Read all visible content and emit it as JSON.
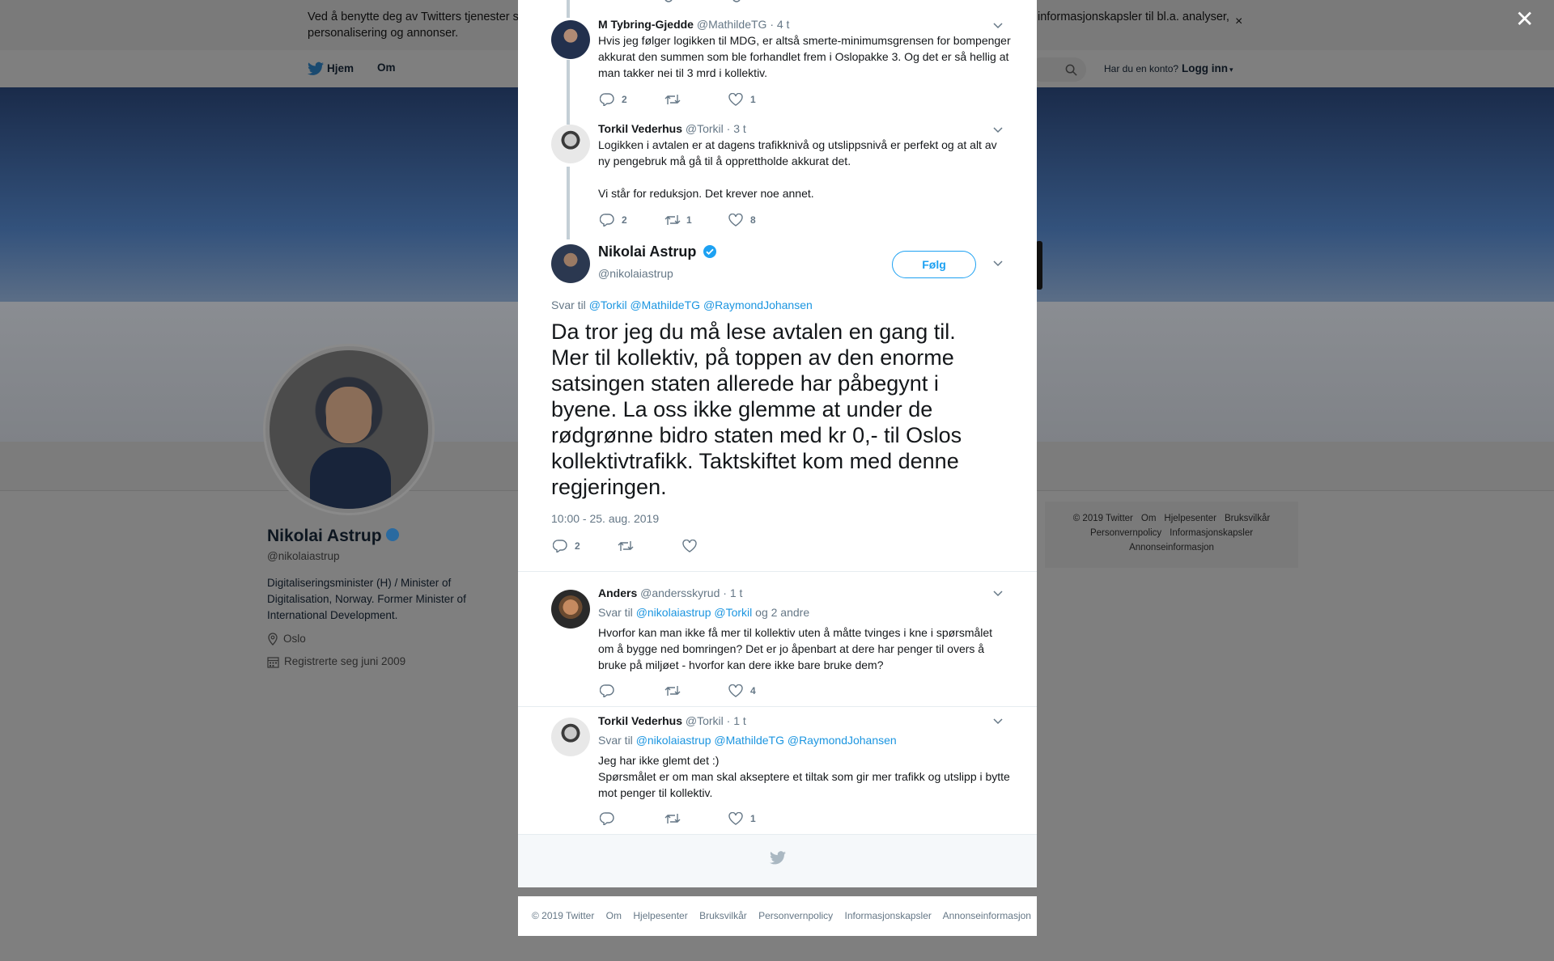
{
  "cookie_bar": {
    "text_left": "Ved å benytte deg av Twitters tjenester sa",
    "text_right": "informasjonskapsler til bl.a. analyser,",
    "text_line2": "personalisering og annonser.",
    "close_label": "×"
  },
  "nav": {
    "home_label": "Hjem",
    "about_label": "Om",
    "account_question": "Har du en konto?",
    "login_label": "Logg inn"
  },
  "profile": {
    "name": "Nikolai Astrup",
    "handle": "@nikolaiastrup",
    "bio": "Digitaliseringsminister (H) / Minister of Digitalisation, Norway. Former Minister of International Development.",
    "location": "Oslo",
    "joined": "Registrerte seg juni 2009"
  },
  "side_footer": {
    "row1": [
      "© 2019 Twitter",
      "Om",
      "Hjelpesenter",
      "Bruksvilkår"
    ],
    "row2": [
      "Personvernpolicy",
      "Informasjonskapsler"
    ],
    "row3": [
      "Annonseinformasjon"
    ]
  },
  "overlay_close": "✕",
  "tweets": [
    {
      "name": "M Tybring-Gjedde",
      "handle": "@MathildeTG",
      "time": "· 4 t",
      "text": "Hvis jeg følger logikken til MDG, er altså smerte-minimumsgrensen for bompenger akkurat den summen som ble forhandlet frem i Oslopakke 3. Og det er så hellig at man takker nei til 3 mrd i kollektiv.",
      "replies": "2",
      "retweets": "",
      "likes": "1"
    },
    {
      "name": "Torkil Vederhus",
      "handle": "@Torkil",
      "time": "· 3 t",
      "text_p1": "Logikken i avtalen er at dagens trafikknivå og utslippsnivå er perfekt og at alt av ny pengebruk må gå til å opprettholde akkurat det.",
      "text_p2": "Vi står for reduksjon. Det krever noe annet.",
      "replies": "2",
      "retweets": "1",
      "likes": "8"
    }
  ],
  "main_tweet": {
    "name": "Nikolai Astrup",
    "handle": "@nikolaiastrup",
    "follow_label": "Følg",
    "reply_prefix": "Svar til",
    "reply_mentions": [
      "@Torkil",
      "@MathildeTG",
      "@RaymondJohansen"
    ],
    "text": "Da tror jeg du må lese avtalen en gang til. Mer til kollektiv, på toppen av den enorme satsingen staten allerede har påbegynt i byene. La oss ikke glemme at under de rødgrønne bidro staten med kr 0,- til Oslos kollektivtrafikk. Taktskiftet kom med denne regjeringen.",
    "timestamp": "10:00 - 25. aug. 2019",
    "replies": "2",
    "retweets": "",
    "likes": ""
  },
  "replies": [
    {
      "name": "Anders",
      "handle": "@andersskyrud",
      "time": "· 1 t",
      "reply_prefix": "Svar til",
      "mentions": [
        "@nikolaiastrup",
        "@Torkil"
      ],
      "reply_suffix": "og 2 andre",
      "text": "Hvorfor kan man ikke få mer til kollektiv uten å måtte tvinges i kne i spørsmålet om å bygge ned bomringen? Det er jo åpenbart at dere har penger til overs å bruke på miljøet - hvorfor kan dere ikke bare bruke dem?",
      "replies": "",
      "retweets": "",
      "likes": "4"
    },
    {
      "name": "Torkil Vederhus",
      "handle": "@Torkil",
      "time": "· 1 t",
      "reply_prefix": "Svar til",
      "mentions": [
        "@nikolaiastrup",
        "@MathildeTG",
        "@RaymondJohansen"
      ],
      "text_l1": "Jeg har ikke glemt det :)",
      "text_l2": "Spørsmålet er om man skal akseptere et tiltak som gir mer trafikk og utslipp i bytte mot penger til kollektiv.",
      "replies": "",
      "retweets": "",
      "likes": "1"
    }
  ],
  "bottom_footer": [
    "© 2019 Twitter",
    "Om",
    "Hjelpesenter",
    "Bruksvilkår",
    "Personvernpolicy",
    "Informasjonskapsler",
    "Annonseinformasjon"
  ],
  "colors": {
    "accent": "#1da1f2",
    "link": "#1b95e0",
    "muted": "#657786",
    "overlay": "#7f7f7f",
    "like_red": "#e0245e"
  }
}
